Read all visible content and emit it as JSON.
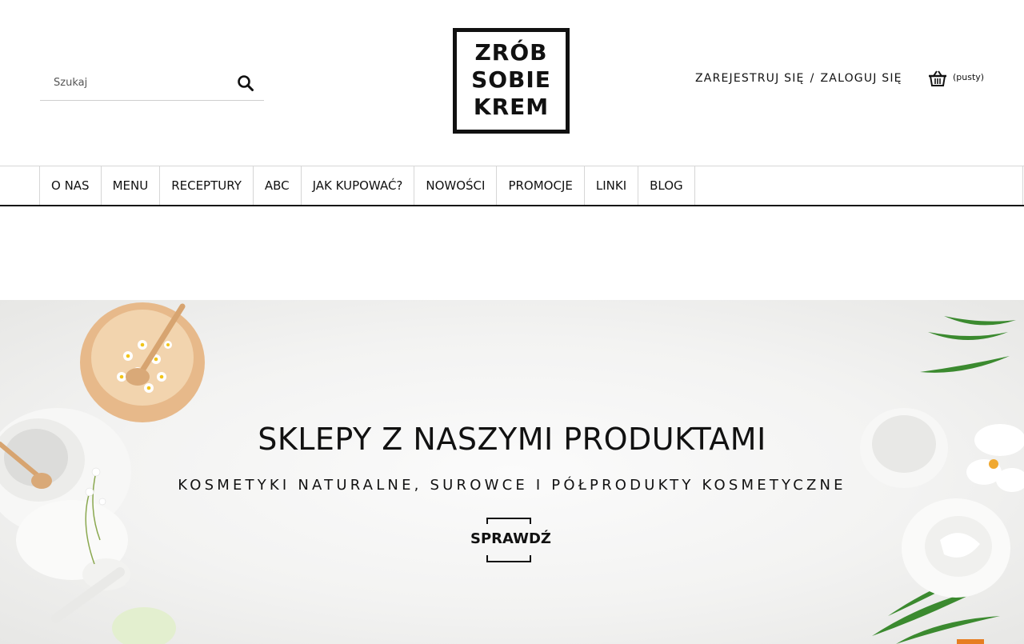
{
  "search": {
    "placeholder": "Szukaj"
  },
  "logo": {
    "lines": [
      "ZRÓB",
      "SOBIE",
      "KREM"
    ]
  },
  "account": {
    "register": "ZAREJESTRUJ SIĘ",
    "separator": "/",
    "login": "ZALOGUJ SIĘ"
  },
  "cart": {
    "status": "(pusty)"
  },
  "nav": {
    "items": [
      "O NAS",
      "MENU",
      "RECEPTURY",
      "ABC",
      "JAK KUPOWAĆ?",
      "NOWOŚCI",
      "PROMOCJE",
      "LINKI",
      "BLOG"
    ]
  },
  "hero": {
    "title": "SKLEPY Z NASZYMI PRODUKTAMI",
    "subtitle": "KOSMETYKI NATURALNE, SUROWCE I PÓŁPRODUKTY KOSMETYCZNE",
    "cta": "SPRAWDŹ"
  },
  "colors": {
    "text": "#111111",
    "accent": "#e67e22",
    "divider": "#d6d6d6"
  },
  "icons": {
    "search": "search-icon",
    "cart": "basket-icon"
  }
}
